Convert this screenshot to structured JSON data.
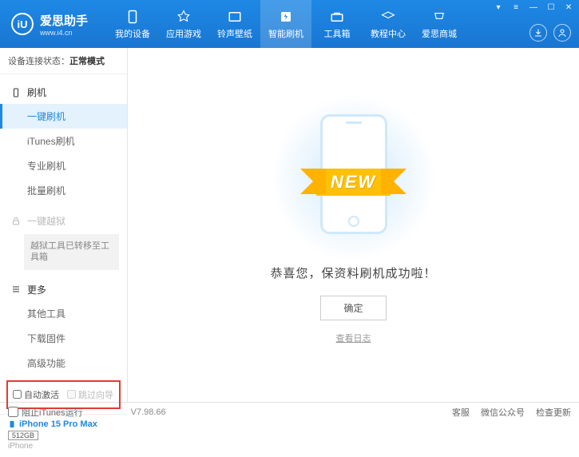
{
  "brand": {
    "logo_letter": "iU",
    "title": "爱思助手",
    "url": "www.i4.cn"
  },
  "nav": [
    {
      "key": "device",
      "label": "我的设备"
    },
    {
      "key": "apps",
      "label": "应用游戏"
    },
    {
      "key": "ringtone",
      "label": "铃声壁纸"
    },
    {
      "key": "flash",
      "label": "智能刷机"
    },
    {
      "key": "toolbox",
      "label": "工具箱"
    },
    {
      "key": "tutorial",
      "label": "教程中心"
    },
    {
      "key": "store",
      "label": "爱思商城"
    }
  ],
  "status": {
    "label": "设备连接状态：",
    "value": "正常模式"
  },
  "sidebar": {
    "flash": {
      "head": "刷机",
      "items": [
        "一键刷机",
        "iTunes刷机",
        "专业刷机",
        "批量刷机"
      ]
    },
    "jailbreak": {
      "head": "一键越狱",
      "note": "越狱工具已转移至工具箱"
    },
    "more": {
      "head": "更多",
      "items": [
        "其他工具",
        "下载固件",
        "高级功能"
      ]
    }
  },
  "checkboxes": {
    "auto_activate": "自动激活",
    "skip_guide": "跳过向导"
  },
  "device": {
    "name": "iPhone 15 Pro Max",
    "storage": "512GB",
    "type": "iPhone"
  },
  "main": {
    "ribbon": "NEW",
    "message": "恭喜您，保资料刷机成功啦！",
    "ok": "确定",
    "log_link": "查看日志"
  },
  "footer": {
    "block_itunes": "阻止iTunes运行",
    "version": "V7.98.66",
    "links": [
      "客服",
      "微信公众号",
      "检查更新"
    ]
  }
}
